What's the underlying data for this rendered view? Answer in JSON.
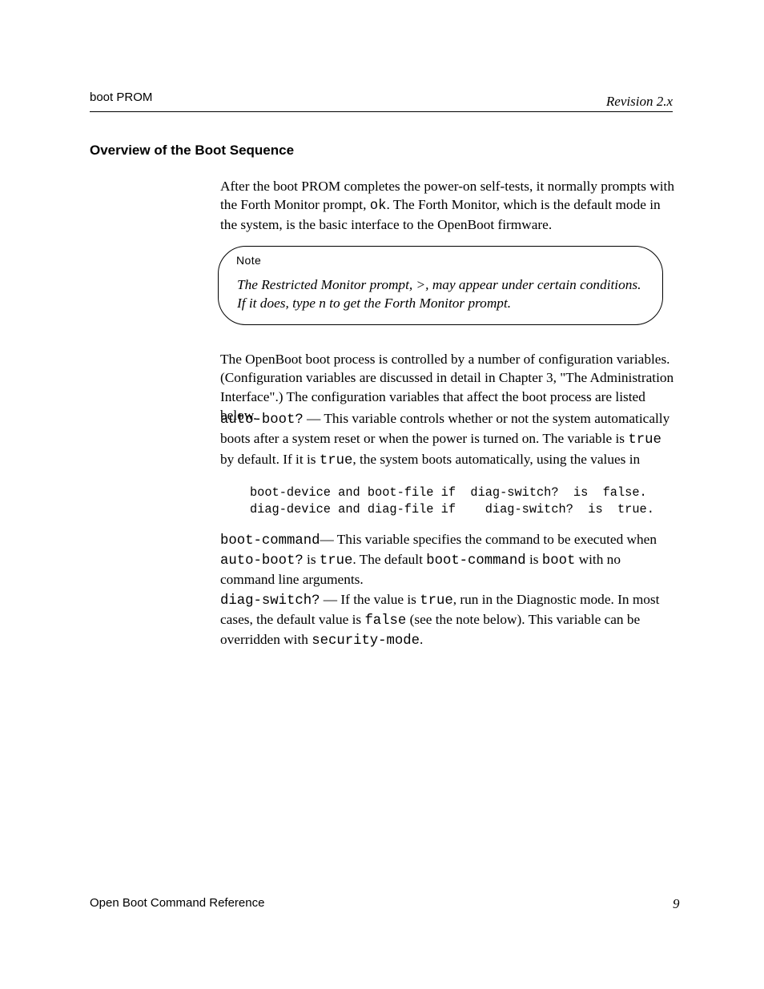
{
  "header": {
    "left": "boot  PROM",
    "right": "Revision  2.x"
  },
  "section_title": "Overview of the Boot Sequence",
  "p1_a": "After the boot PROM completes the power-on self-tests, it normally prompts with the Forth Monitor prompt, ",
  "p1_b": "ok",
  "p1_c": ". The Forth Monitor, which is the default mode in the system, is the basic interface to the OpenBoot firmware.",
  "callout_heading": "Note",
  "callout_body": "The Restricted Monitor prompt,  >,  may appear under certain conditions.  If it does, type  n to get the Forth Monitor prompt.",
  "p2": "The OpenBoot boot process is controlled by a number of configuration variables. (Configuration variables are discussed in detail in Chapter 3, \"The Administration Interface\".) The configuration variables that affect the boot process are listed below.",
  "p3_a": "auto-boot?",
  "p3_b": " — This variable controls whether or not the system automatically boots after a system reset or when the power is turned on. The variable is ",
  "p3_c": "true",
  "p3_d": " by default. If it is ",
  "p3_e": "true",
  "p3_f": ", the system boots automatically, using the values in",
  "code_line1": "boot-device and boot-file if  diag-switch?  is  false.",
  "code_line2": "diag-device and diag-file if    diag-switch?  is  true.",
  "p4_a": "boot-command",
  "p4_b": "— This variable specifies the command to be executed when ",
  "p4_c": "auto-boot?",
  "p4_d": " is ",
  "p4_e": "true",
  "p4_f": ". The default ",
  "p4_g": "boot-command",
  "p4_h": " is ",
  "p4_i": "boot",
  "p4_j": " with no command line arguments.",
  "p5_a": "diag-switch?",
  "p5_b": " — If the value is ",
  "p5_c": "true",
  "p5_d": ", run in the Diagnostic mode. In most cases, the default value is ",
  "p5_e": "false",
  "p5_f": " (see the note below). This variable can be overridden with ",
  "p5_g": "security-mode",
  "p5_h": ".",
  "footer": {
    "left": "Open Boot Command Reference",
    "right": "9"
  }
}
